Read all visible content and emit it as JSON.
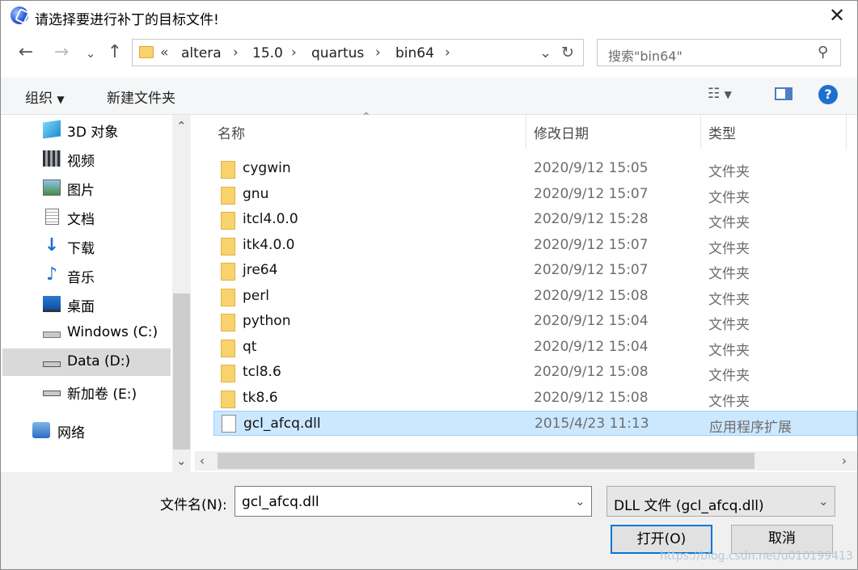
{
  "dialog": {
    "title": "请选择要进行补丁的目标文件!"
  },
  "nav": {
    "breadcrumbs": [
      "«",
      "altera",
      "15.0",
      "quartus",
      "bin64"
    ],
    "search_placeholder": "搜索\"bin64\""
  },
  "toolbar": {
    "organize_label": "组织",
    "new_folder_label": "新建文件夹"
  },
  "sidebar": {
    "items": [
      {
        "label": "3D 对象",
        "icon": "cube-3d-icon"
      },
      {
        "label": "视频",
        "icon": "video-icon"
      },
      {
        "label": "图片",
        "icon": "picture-icon"
      },
      {
        "label": "文档",
        "icon": "document-icon"
      },
      {
        "label": "下载",
        "icon": "download-icon"
      },
      {
        "label": "音乐",
        "icon": "music-icon"
      },
      {
        "label": "桌面",
        "icon": "desktop-icon"
      },
      {
        "label": "Windows (C:)",
        "icon": "windows-drive-icon"
      },
      {
        "label": "Data (D:)",
        "icon": "drive-icon",
        "selected": true
      },
      {
        "label": "新加卷 (E:)",
        "icon": "drive-icon"
      },
      {
        "label": "网络",
        "icon": "network-icon"
      }
    ]
  },
  "file_list": {
    "columns": [
      "名称",
      "修改日期",
      "类型"
    ],
    "rows": [
      {
        "name": "cygwin",
        "date": "2020/9/12 15:05",
        "type": "文件夹",
        "icon": "folder-icon"
      },
      {
        "name": "gnu",
        "date": "2020/9/12 15:07",
        "type": "文件夹",
        "icon": "folder-icon"
      },
      {
        "name": "itcl4.0.0",
        "date": "2020/9/12 15:28",
        "type": "文件夹",
        "icon": "folder-icon"
      },
      {
        "name": "itk4.0.0",
        "date": "2020/9/12 15:07",
        "type": "文件夹",
        "icon": "folder-icon"
      },
      {
        "name": "jre64",
        "date": "2020/9/12 15:07",
        "type": "文件夹",
        "icon": "folder-icon"
      },
      {
        "name": "perl",
        "date": "2020/9/12 15:08",
        "type": "文件夹",
        "icon": "folder-icon"
      },
      {
        "name": "python",
        "date": "2020/9/12 15:04",
        "type": "文件夹",
        "icon": "folder-icon"
      },
      {
        "name": "qt",
        "date": "2020/9/12 15:04",
        "type": "文件夹",
        "icon": "folder-icon"
      },
      {
        "name": "tcl8.6",
        "date": "2020/9/12 15:08",
        "type": "文件夹",
        "icon": "folder-icon"
      },
      {
        "name": "tk8.6",
        "date": "2020/9/12 15:08",
        "type": "文件夹",
        "icon": "folder-icon"
      },
      {
        "name": "gcl_afcq.dll",
        "date": "2015/4/23 11:13",
        "type": "应用程序扩展",
        "icon": "dll-file-icon",
        "selected": true
      }
    ]
  },
  "footer": {
    "filename_label": "文件名(N):",
    "filename_value": "gcl_afcq.dll",
    "filetype_value": "DLL 文件 (gcl_afcq.dll)",
    "open_label": "打开(O)",
    "cancel_label": "取消",
    "watermark": "https://blog.csdn.net/u010199413"
  },
  "colors": {
    "selection": "#cce8ff",
    "accent": "#0078d7",
    "help": "#1f6fd1"
  }
}
